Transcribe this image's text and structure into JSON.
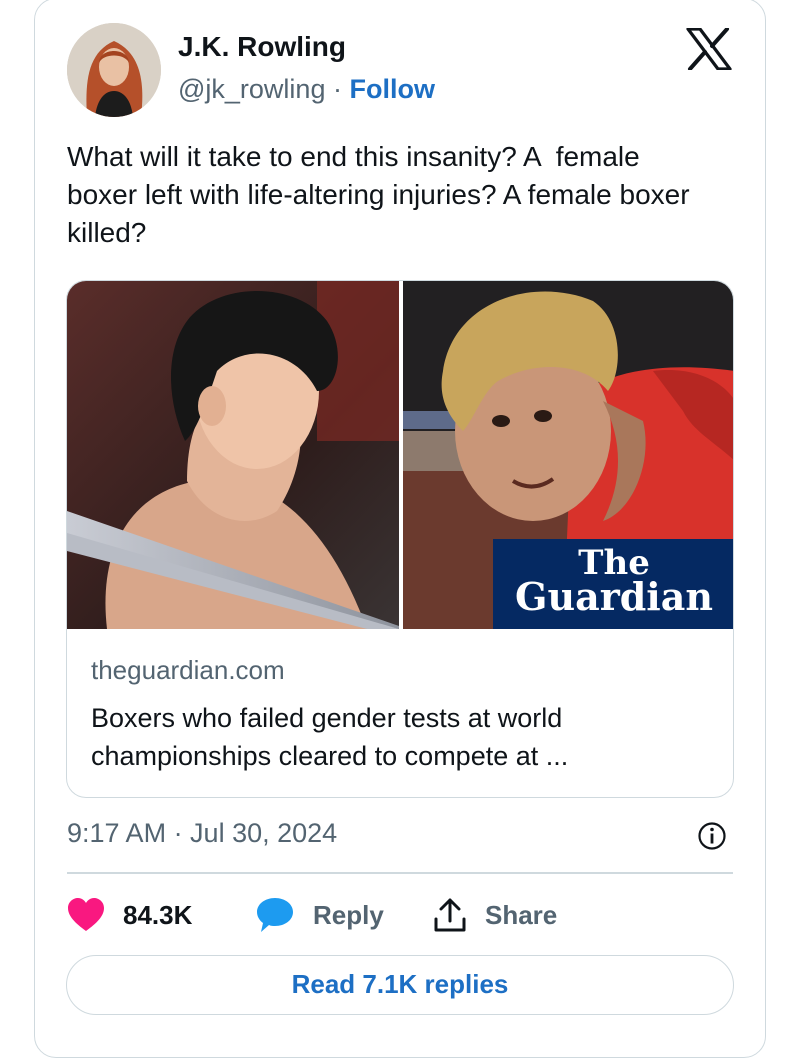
{
  "author": {
    "name": "J.K. Rowling",
    "handle": "@jk_rowling",
    "separator": "·",
    "follow_label": "Follow"
  },
  "tweet": {
    "text": "What will it take to end this insanity? A  female boxer left with life-altering injuries? A female boxer killed?"
  },
  "link_card": {
    "logo_line1": "The",
    "logo_line2": "Guardian",
    "domain": "theguardian.com",
    "headline": "Boxers who failed gender tests at world championships cleared to compete at ..."
  },
  "meta": {
    "timestamp": "9:17 AM · Jul 30, 2024"
  },
  "actions": {
    "likes": "84.3K",
    "reply_label": "Reply",
    "share_label": "Share"
  },
  "read_replies_label": "Read 7.1K replies",
  "icons": {
    "platform": "x-logo-icon",
    "like": "heart-icon",
    "reply": "speech-bubble-icon",
    "share": "share-arrow-icon",
    "info": "info-icon"
  },
  "colors": {
    "link_blue": "#1d6fc4",
    "like_red": "#f91880",
    "reply_blue": "#1d9bf0",
    "muted_gray": "#536471",
    "guardian_navy": "#052962"
  }
}
